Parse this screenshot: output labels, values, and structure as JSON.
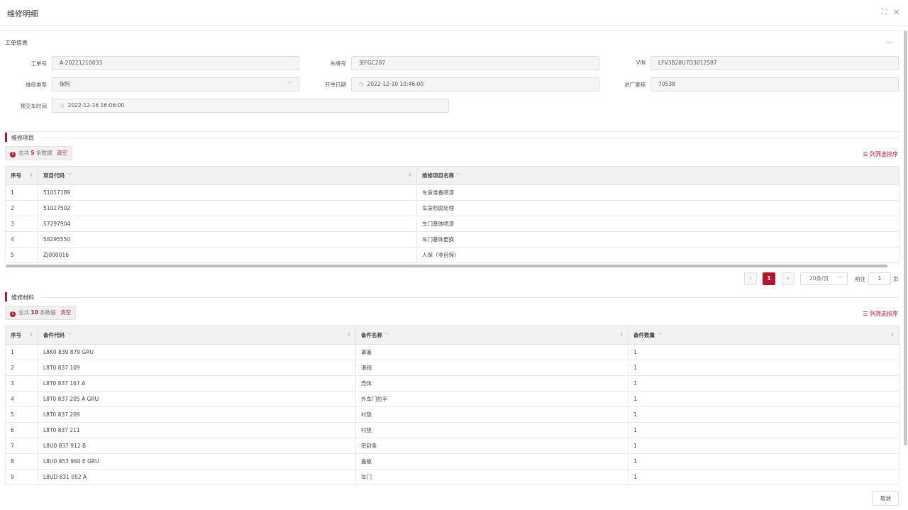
{
  "modal": {
    "title": "维修明细",
    "cancel_label": "取消"
  },
  "work_order": {
    "section_title": "工单信息",
    "fields": {
      "order_no_label": "工单号",
      "order_no": "A-20221210033",
      "plate_label": "车牌号",
      "plate": "京FGC287",
      "vin_label": "VIN",
      "vin": "LFV3B28U7D3012587",
      "repair_type_label": "维修类型",
      "repair_type": "保险",
      "open_date_label": "开单日期",
      "open_date": "2022-12-10 10:46:00",
      "mileage_label": "进厂里程",
      "mileage": "70538",
      "delivery_time_label": "预交车时间",
      "delivery_time": "2022-12-16 16:06:00"
    }
  },
  "repair_items": {
    "title": "维修项目",
    "summary_prefix": "总共",
    "count": "5",
    "summary_suffix": "条数据",
    "clear_label": "清空",
    "column_filter_label": "列筛选排序",
    "columns": [
      "序号",
      "项目代码",
      "维修项目名称"
    ],
    "rows": [
      [
        "1",
        "51017189",
        "车身准备喷漆"
      ],
      [
        "2",
        "51017502",
        "车身防腐处理"
      ],
      [
        "3",
        "57297904",
        "车门基体喷漆"
      ],
      [
        "4",
        "58295550",
        "车门基体更换"
      ],
      [
        "5",
        "ZJ000016",
        "人保（非自保)"
      ]
    ]
  },
  "pagination": {
    "current_page": "1",
    "page_size": "20条/页",
    "goto_label": "前往",
    "goto_value": "1",
    "page_unit": "页"
  },
  "repair_materials": {
    "title": "维修材料",
    "summary_prefix": "总共",
    "count": "10",
    "summary_suffix": "条数据",
    "clear_label": "清空",
    "column_filter_label": "列筛选排序",
    "columns": [
      "序号",
      "备件代码",
      "备件名称",
      "备件数量"
    ],
    "rows": [
      [
        "1",
        "L8K0 839 879 GRU",
        "罩盖",
        "1"
      ],
      [
        "2",
        "L8T0 837 109",
        "滑阀",
        "1"
      ],
      [
        "3",
        "L8T0 837 167 A",
        "壳体",
        "1"
      ],
      [
        "4",
        "L8T0 837 205 A GRU",
        "外车门拉手",
        "1"
      ],
      [
        "5",
        "L8T0 837 209",
        "衬垫",
        "1"
      ],
      [
        "6",
        "L8T0 837 211",
        "衬垫",
        "1"
      ],
      [
        "7",
        "L8U0 837 912 B",
        "密封条",
        "1"
      ],
      [
        "8",
        "L8U0 853 960 E GRU",
        "盖板",
        "1"
      ],
      [
        "9",
        "L8UD 831 052 A",
        "车门",
        "1"
      ]
    ]
  },
  "colors": {
    "accent": "#b5162b"
  },
  "icons": [
    "fullscreen-icon",
    "close-icon",
    "collapse-icon",
    "chevron-down-icon",
    "clock-icon",
    "info-icon",
    "filter-lines-icon",
    "sort-icon",
    "chevron-left-icon",
    "chevron-right-icon"
  ]
}
